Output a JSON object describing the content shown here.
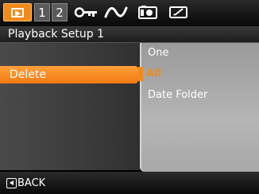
{
  "mode_bar": {
    "tabs": [
      {
        "type": "playback",
        "icon": "playback-icon",
        "active": true
      },
      {
        "type": "number",
        "label": "1"
      },
      {
        "type": "number",
        "label": "2"
      }
    ],
    "icons": [
      "key-icon",
      "wave-icon",
      "camera-icon",
      "edit-screen-icon"
    ],
    "accent_color": "#f08a1c"
  },
  "title": "Playback Setup 1",
  "menu": {
    "selected_item": "Delete"
  },
  "submenu": {
    "options": [
      "One",
      "All",
      "Date Folder"
    ],
    "highlighted": "All"
  },
  "footer": {
    "back_label": "BACK",
    "back_icon": "back-arrow-icon"
  }
}
